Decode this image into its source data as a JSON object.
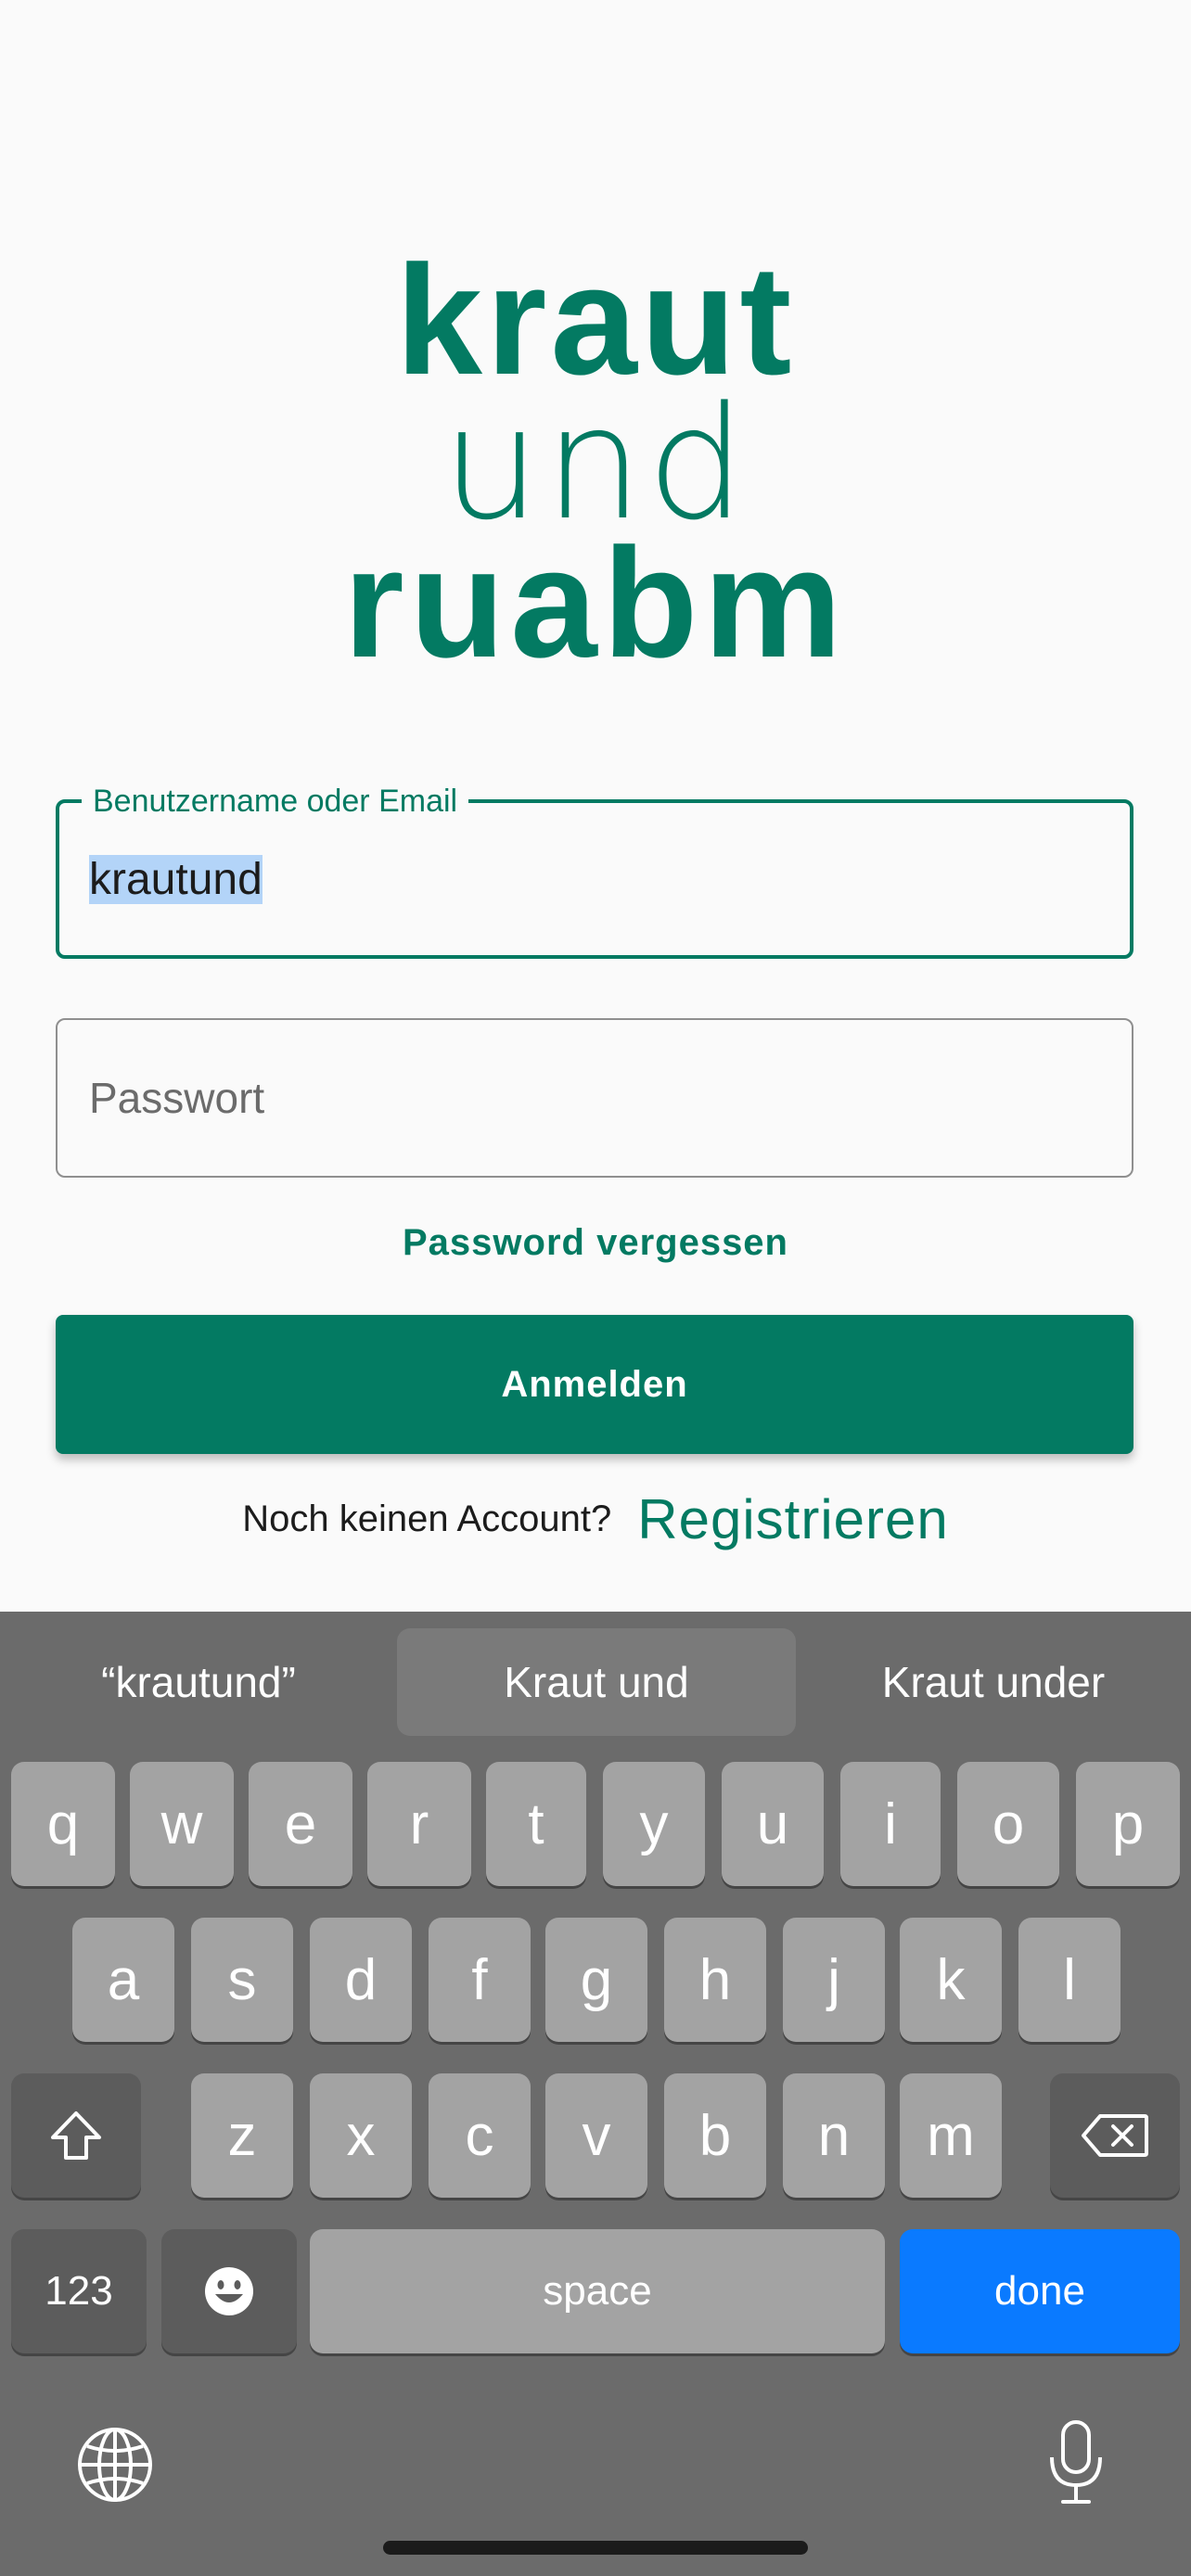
{
  "logo": {
    "line1": "kraut",
    "line2": "und",
    "line3": "ruabm"
  },
  "form": {
    "username": {
      "label": "Benutzername oder Email",
      "value": "krautund"
    },
    "password": {
      "placeholder": "Passwort"
    },
    "forgot_label": "Password vergessen",
    "login_label": "Anmelden",
    "register_prompt": "Noch keinen Account?",
    "register_label": "Registrieren"
  },
  "keyboard": {
    "suggestions": [
      "“krautund”",
      "Kraut und",
      "Kraut under"
    ],
    "row1": [
      "q",
      "w",
      "e",
      "r",
      "t",
      "y",
      "u",
      "i",
      "o",
      "p"
    ],
    "row2": [
      "a",
      "s",
      "d",
      "f",
      "g",
      "h",
      "j",
      "k",
      "l"
    ],
    "row3": [
      "z",
      "x",
      "c",
      "v",
      "b",
      "n",
      "m"
    ],
    "numbers_label": "123",
    "space_label": "space",
    "done_label": "done"
  },
  "colors": {
    "brand": "#037a62",
    "done_key": "#0a7aff",
    "selection": "#b3d4f8"
  },
  "icons": [
    "shift-icon",
    "backspace-icon",
    "emoji-icon",
    "globe-icon",
    "microphone-icon"
  ]
}
